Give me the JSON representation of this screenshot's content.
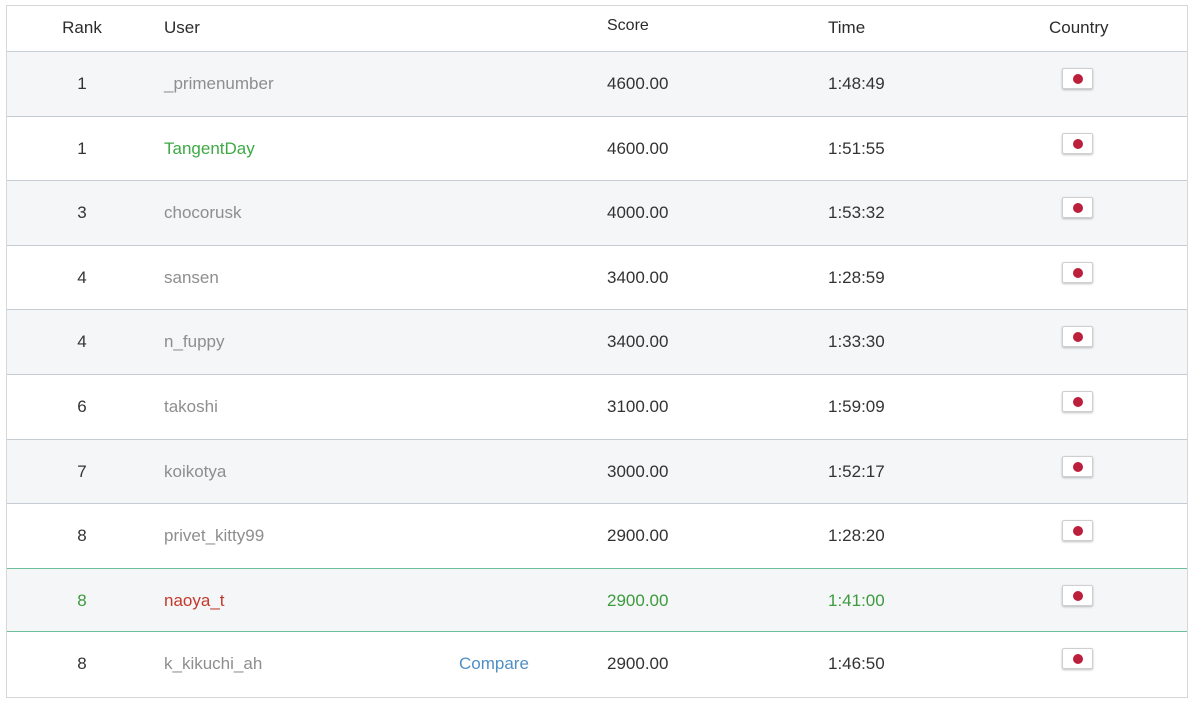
{
  "table": {
    "headers": {
      "rank": "Rank",
      "user": "User",
      "score": "Score",
      "time": "Time",
      "country": "Country"
    },
    "rows": [
      {
        "rank": "1",
        "user": "_primenumber",
        "compare": "",
        "score": "4600.00",
        "time": "1:48:49",
        "country_icon": "japan-flag-icon"
      },
      {
        "rank": "1",
        "user": "TangentDay",
        "compare": "",
        "score": "4600.00",
        "time": "1:51:55",
        "country_icon": "japan-flag-icon"
      },
      {
        "rank": "3",
        "user": "chocorusk",
        "compare": "",
        "score": "4000.00",
        "time": "1:53:32",
        "country_icon": "japan-flag-icon"
      },
      {
        "rank": "4",
        "user": "sansen",
        "compare": "",
        "score": "3400.00",
        "time": "1:28:59",
        "country_icon": "japan-flag-icon"
      },
      {
        "rank": "4",
        "user": "n_fuppy",
        "compare": "",
        "score": "3400.00",
        "time": "1:33:30",
        "country_icon": "japan-flag-icon"
      },
      {
        "rank": "6",
        "user": "takoshi",
        "compare": "",
        "score": "3100.00",
        "time": "1:59:09",
        "country_icon": "japan-flag-icon"
      },
      {
        "rank": "7",
        "user": "koikotya",
        "compare": "",
        "score": "3000.00",
        "time": "1:52:17",
        "country_icon": "japan-flag-icon"
      },
      {
        "rank": "8",
        "user": "privet_kitty99",
        "compare": "",
        "score": "2900.00",
        "time": "1:28:20",
        "country_icon": "japan-flag-icon"
      },
      {
        "rank": "8",
        "user": "naoya_t",
        "compare": "",
        "score": "2900.00",
        "time": "1:41:00",
        "country_icon": "japan-flag-icon"
      },
      {
        "rank": "8",
        "user": "k_kikuchi_ah",
        "compare": "Compare",
        "score": "2900.00",
        "time": "1:46:50",
        "country_icon": "japan-flag-icon"
      }
    ]
  },
  "colors": {
    "highlight_border": "#6dbf9c",
    "highlight_text": "#3d9a3d",
    "current_user": "#c5392b",
    "green_user": "#3daa44",
    "gray_user": "#8e8e8e",
    "link": "#4f8fc4",
    "flag_red": "#bc1f3c"
  }
}
